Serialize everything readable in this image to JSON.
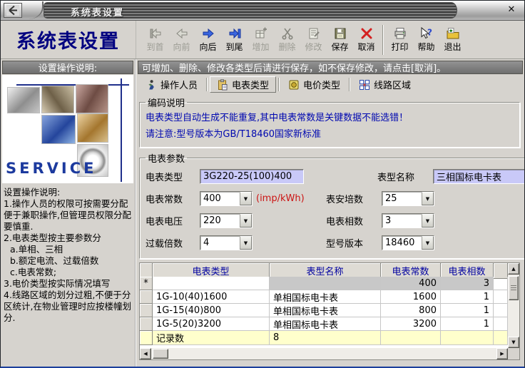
{
  "window": {
    "title": "系统表设置",
    "close_label": "✕",
    "logo_icon": "app-logo-icon"
  },
  "header": {
    "app_title": "系统表设置"
  },
  "toolbar": {
    "buttons": [
      {
        "id": "first",
        "label": "到首",
        "icon": "nav-first-icon",
        "enabled": false
      },
      {
        "id": "prev",
        "label": "向前",
        "icon": "nav-prev-icon",
        "enabled": false
      },
      {
        "id": "next",
        "label": "向后",
        "icon": "nav-next-icon",
        "enabled": true
      },
      {
        "id": "last",
        "label": "到尾",
        "icon": "nav-last-icon",
        "enabled": true
      },
      {
        "id": "add",
        "label": "增加",
        "icon": "add-icon",
        "enabled": false
      },
      {
        "id": "delete",
        "label": "删除",
        "icon": "delete-icon",
        "enabled": false
      },
      {
        "id": "modify",
        "label": "修改",
        "icon": "modify-icon",
        "enabled": false
      },
      {
        "id": "save",
        "label": "保存",
        "icon": "save-icon",
        "enabled": true
      },
      {
        "id": "cancel",
        "label": "取消",
        "icon": "cancel-icon",
        "enabled": true,
        "separator_after": true
      },
      {
        "id": "print",
        "label": "打印",
        "icon": "print-icon",
        "enabled": true
      },
      {
        "id": "help",
        "label": "帮助",
        "icon": "help-icon",
        "enabled": true
      },
      {
        "id": "exit",
        "label": "退出",
        "icon": "exit-icon",
        "enabled": true
      }
    ]
  },
  "left_panel": {
    "header": "设置操作说明:",
    "service_label": "SERVICE",
    "instructions": [
      {
        "text": "设置操作说明:",
        "indent": false
      },
      {
        "text": "1.操作人员的权限可按需要分配便于兼职操作,但管理员权限分配要慎重.",
        "indent": false
      },
      {
        "text": "2.电表类型按主要参数分",
        "indent": false
      },
      {
        "text": "a.单相、三相",
        "indent": true
      },
      {
        "text": "b.额定电流、过载倍数",
        "indent": true
      },
      {
        "text": "c.电表常数;",
        "indent": true
      },
      {
        "text": "3.电价类型按实际情况填写",
        "indent": false
      },
      {
        "text": "4.线路区域的划分过粗,不便于分区统计,在物业管理时应按楼幢划分.",
        "indent": false
      }
    ]
  },
  "right_panel": {
    "notice": "可增加、删除、修改各类型后请进行保存，如不保存修改，请点击[取消]。",
    "tabs": [
      {
        "label": "操作人员",
        "icon": "operator-icon",
        "selected": false
      },
      {
        "label": "电表类型",
        "icon": "meter-type-icon",
        "selected": true
      },
      {
        "label": "电价类型",
        "icon": "price-type-icon",
        "selected": false
      },
      {
        "label": "线路区域",
        "icon": "line-area-icon",
        "selected": false
      }
    ],
    "coding_box": {
      "title": "编码说明",
      "line1": "电表类型自动生成不能重复,其中电表常数是关键数据不能选错！",
      "line2": "请注意:型号版本为GB/T18460国家新标准"
    },
    "params_box": {
      "title": "电表参数",
      "fields": {
        "meter_type": {
          "label": "电表类型",
          "value": "3G220-25(100)400"
        },
        "model_name": {
          "label": "表型名称",
          "value": "三相国标电卡表"
        },
        "meter_constant": {
          "label": "电表常数",
          "value": "400",
          "suffix": "(imp/kWh)"
        },
        "ampere": {
          "label": "表安培数",
          "value": "25"
        },
        "voltage": {
          "label": "电表电压",
          "value": "220"
        },
        "phases": {
          "label": "电表相数",
          "value": "3"
        },
        "overload": {
          "label": "过载倍数",
          "value": "4"
        },
        "model_version": {
          "label": "型号版本",
          "value": "18460"
        }
      }
    },
    "table": {
      "headers": [
        "电表类型",
        "表型名称",
        "电表常数",
        "电表相数"
      ],
      "rows": [
        {
          "selector": "*",
          "meter_type": "",
          "model_name": "",
          "constant": "400",
          "phases": "3",
          "is_new": true
        },
        {
          "selector": "",
          "meter_type": "1G-10(40)1600",
          "model_name": "单相国标电卡表",
          "constant": "1600",
          "phases": "1",
          "is_new": false
        },
        {
          "selector": "",
          "meter_type": "1G-15(40)800",
          "model_name": "单相国标电卡表",
          "constant": "800",
          "phases": "1",
          "is_new": false
        },
        {
          "selector": "",
          "meter_type": "1G-5(20)3200",
          "model_name": "单相国标电卡表",
          "constant": "3200",
          "phases": "1",
          "is_new": false
        }
      ],
      "footer": {
        "label": "记录数",
        "value": "8"
      }
    }
  },
  "colors": {
    "title_navy": "#000080",
    "notice_bg": "#7b7b7b",
    "field_lavender": "#c9c9f8",
    "coding_blue": "#0008b0",
    "suffix_red": "#cc1414",
    "table_header_text": "#0000a0",
    "footer_yellow": "#ffffcc",
    "new_row_gray": "#c8c8c8"
  }
}
